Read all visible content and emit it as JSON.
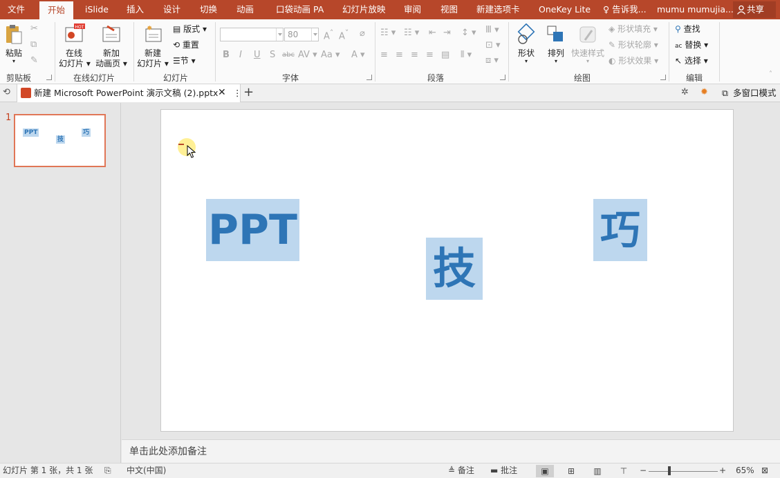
{
  "tabs": {
    "file": "文件",
    "home": "开始",
    "islide": "iSlide",
    "insert": "插入",
    "design": "设计",
    "transitions": "切换",
    "animations": "动画",
    "pocket_animation": "口袋动画 PA",
    "slideshow": "幻灯片放映",
    "review": "审阅",
    "view": "视图",
    "new_tab": "新建选项卡",
    "onekey": "OneKey Lite"
  },
  "tell_me": "告诉我...",
  "user_name": "mumu mumujia...",
  "share": "共享",
  "ribbon": {
    "clipboard": {
      "label": "剪贴板",
      "paste": "粘贴"
    },
    "online_slides": {
      "label": "在线幻灯片",
      "online": [
        "在线",
        "幻灯片"
      ],
      "new_anim": [
        "新加",
        "动画页"
      ],
      "hot_badge": "HOT"
    },
    "slides": {
      "label": "幻灯片",
      "new_slide": [
        "新建",
        "幻灯片"
      ],
      "layout": "版式",
      "reset": "重置",
      "section": "节"
    },
    "font": {
      "label": "字体",
      "font_name": "",
      "font_size": "80"
    },
    "paragraph": {
      "label": "段落"
    },
    "drawing": {
      "label": "绘图",
      "shapes": "形状",
      "arrange": "排列",
      "quick_styles": "快速样式",
      "fill": "形状填充",
      "outline": "形状轮廓",
      "effects": "形状效果"
    },
    "editing": {
      "label": "编辑",
      "find": "查找",
      "replace": "替换",
      "select": "选择"
    }
  },
  "document_tab": {
    "title": "新建 Microsoft PowerPoint 演示文稿 (2).pptx"
  },
  "multi_window": "多窗口模式",
  "thumbnail": {
    "slide_number": "1",
    "words": [
      "PPT",
      "技",
      "巧"
    ]
  },
  "slide": {
    "words": [
      "PPT",
      "技",
      "巧"
    ]
  },
  "notes_placeholder": "单击此处添加备注",
  "status": {
    "slide_info": "幻灯片 第 1 张，共 1 张",
    "language": "中文(中国)",
    "notes": "备注",
    "comments": "批注",
    "zoom": "65%"
  },
  "colors": {
    "accent": "#b7472a",
    "text_fill": "#bdd7ee",
    "text_color": "#2e75b6"
  }
}
